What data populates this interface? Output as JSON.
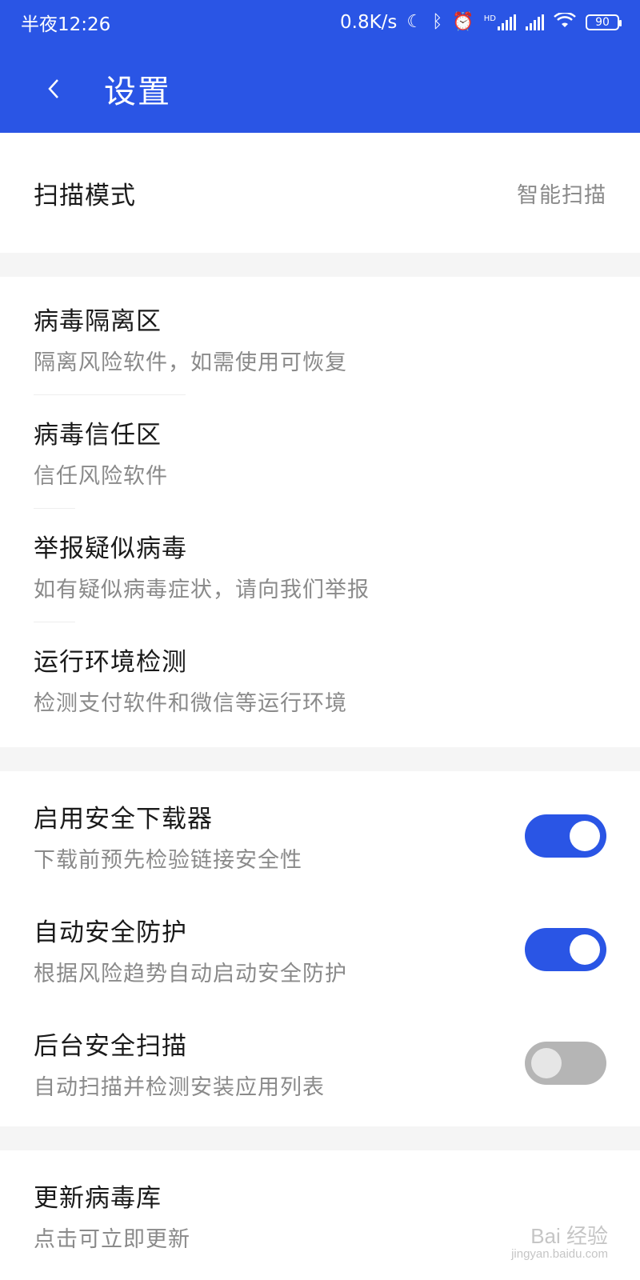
{
  "status_bar": {
    "time": "半夜12:26",
    "network_speed": "0.8K/s",
    "hd_label": "HD",
    "battery": "90"
  },
  "header": {
    "title": "设置",
    "back_icon": "chevron-left-icon"
  },
  "scan_mode": {
    "label": "扫描模式",
    "value": "智能扫描"
  },
  "virus_items": [
    {
      "label": "病毒隔离区",
      "sub": "隔离风险软件，如需使用可恢复"
    },
    {
      "label": "病毒信任区",
      "sub": "信任风险软件"
    },
    {
      "label": "举报疑似病毒",
      "sub": "如有疑似病毒症状，请向我们举报"
    },
    {
      "label": "运行环境检测",
      "sub": "检测支付软件和微信等运行环境"
    }
  ],
  "toggles": [
    {
      "label": "启用安全下载器",
      "sub": "下载前预先检验链接安全性",
      "on": true
    },
    {
      "label": "自动安全防护",
      "sub": "根据风险趋势自动启动安全防护",
      "on": true
    },
    {
      "label": "后台安全扫描",
      "sub": "自动扫描并检测安装应用列表",
      "on": false
    }
  ],
  "update": {
    "label": "更新病毒库",
    "sub": "点击可立即更新"
  },
  "watermark": {
    "brand": "Bai 经验",
    "url": "jingyan.baidu.com"
  },
  "colors": {
    "accent": "#2a55e5",
    "toggle_off": "#b5b5b5"
  }
}
